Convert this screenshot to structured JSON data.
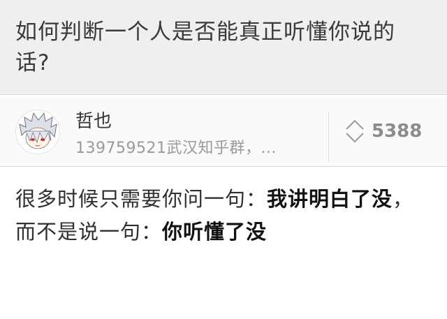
{
  "question": {
    "title": "如何判断一个人是否能真正听懂你说的话?"
  },
  "answer": {
    "author": {
      "name": "哲也",
      "bio": "139759521武汉知乎群，..."
    },
    "votes": "5388",
    "body": [
      {
        "text": "很多时候只需要你问一句：",
        "bold": false
      },
      {
        "text": "我讲明白了没",
        "bold": true
      },
      {
        "text": "，而不是说一句：",
        "bold": false
      },
      {
        "text": "你听懂了没",
        "bold": true
      }
    ]
  },
  "icons": {
    "avatar": "anime-avatar",
    "vote": "updown-arrows-icon"
  },
  "colors": {
    "header_bg": "#efefef",
    "bar_bg": "#fafafa",
    "muted_text": "#9a9a9a",
    "vote_color": "#8c8c8c"
  }
}
